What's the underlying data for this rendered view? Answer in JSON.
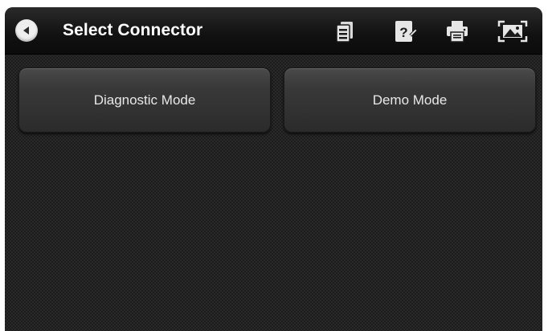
{
  "header": {
    "title": "Select Connector",
    "back_icon": "back-arrow-icon",
    "tools": [
      {
        "icon": "report-list-icon"
      },
      {
        "icon": "help-icon"
      },
      {
        "icon": "print-icon"
      },
      {
        "icon": "screenshot-icon"
      }
    ]
  },
  "modes": [
    {
      "label": "Diagnostic Mode"
    },
    {
      "label": "Demo Mode"
    }
  ],
  "colors": {
    "text": "#ffffff",
    "button_text": "#e8e8e8",
    "background": "#222222"
  }
}
